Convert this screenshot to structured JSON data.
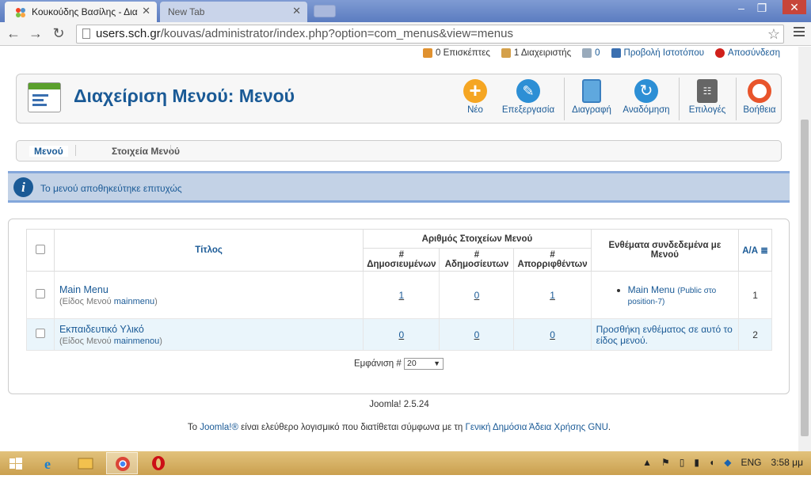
{
  "browser": {
    "tabs": [
      {
        "label": "Κουκούδης Βασίλης - Δια"
      },
      {
        "label": "New Tab"
      }
    ],
    "url": {
      "host": "users.sch.gr",
      "path": "/kouvas/administrator/index.php?option=com_menus&view=menus"
    }
  },
  "status": {
    "visitors": "0 Επισκέπτες",
    "admins": "1 Διαχειριστής",
    "messages": "0",
    "view_site": "Προβολή Ιστοτόπου",
    "logout": "Αποσύνδεση"
  },
  "header": {
    "title": "Διαχείριση Μενού: Μενού",
    "toolbar": {
      "new": "Νέο",
      "edit": "Επεξεργασία",
      "delete": "Διαγραφή",
      "rebuild": "Αναδόμηση",
      "options": "Επιλογές",
      "help": "Βοήθεια"
    }
  },
  "submenu": {
    "items": [
      {
        "label": "Μενού"
      },
      {
        "label": "Στοιχεία Μενού"
      }
    ]
  },
  "message": "Το μενού αποθηκεύτηκε επιτυχώς",
  "table": {
    "headers": {
      "title": "Τίτλος",
      "count_group": "Αριθμός Στοιχείων Μενού",
      "published": "# Δημοσιευμένων",
      "unpublished": "# Αδημοσίευτων",
      "trashed": "# Απορριφθέντων",
      "modules": "Ενθέματα συνδεδεμένα με Μενού",
      "id": "Α/Α"
    },
    "rows": [
      {
        "title": "Main Menu",
        "type_label": "(Είδος Μενού ",
        "type": "mainmenu",
        "type_close": ")",
        "published": "1",
        "unpublished": "0",
        "trashed": "1",
        "module": "Main Menu",
        "module_note": "(Public στο position-7)",
        "id": "1"
      },
      {
        "title": "Εκπαιδευτικό Υλικό",
        "type_label": "(Είδος Μενού ",
        "type": "mainmenou",
        "type_close": ")",
        "published": "0",
        "unpublished": "0",
        "trashed": "0",
        "module_add": "Προσθήκη ενθέματος σε αυτό το είδος μενού.",
        "id": "2"
      }
    ]
  },
  "pagination": {
    "label": "Εμφάνιση #",
    "limit": "20"
  },
  "version": "Joomla! 2.5.24",
  "footer": {
    "prefix": "Το ",
    "joomla": "Joomla!®",
    "middle": " είναι ελεύθερο λογισμικό που διατίθεται σύμφωνα με τη ",
    "license": "Γενική Δημόσια Άδεια Χρήσης GNU",
    "suffix": "."
  },
  "taskbar": {
    "lang": "ENG",
    "time": "3:58 μμ"
  },
  "colors": {
    "accent": "#1a5a96",
    "message_bg": "#c3d2e6"
  }
}
